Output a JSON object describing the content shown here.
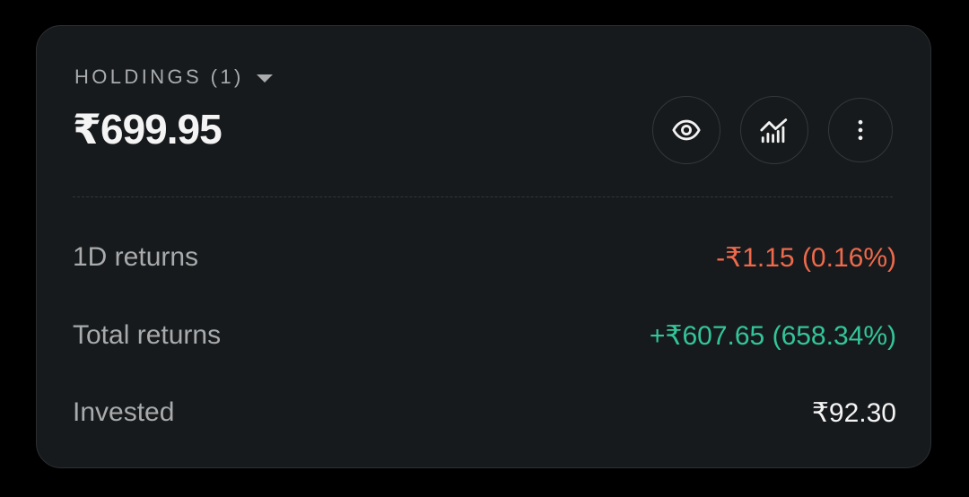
{
  "holdings": {
    "header_label": "HOLDINGS (1)",
    "total_value": "₹699.95",
    "actions": [
      {
        "icon": "eye-icon"
      },
      {
        "icon": "analytics-chart-icon"
      },
      {
        "icon": "more-vertical-icon"
      }
    ]
  },
  "summary": {
    "rows": [
      {
        "label": "1D returns",
        "value": "-₹1.15 (0.16%)",
        "tone": "negative"
      },
      {
        "label": "Total returns",
        "value": "+₹607.65 (658.34%)",
        "tone": "positive"
      },
      {
        "label": "Invested",
        "value": "₹92.30",
        "tone": "neutral"
      }
    ]
  },
  "colors": {
    "background": "#000000",
    "card": "#171a1c",
    "negative": "#ef6a4c",
    "positive": "#33c59a",
    "primary_text": "#f4f4f4",
    "secondary_text": "#a8aaac"
  }
}
